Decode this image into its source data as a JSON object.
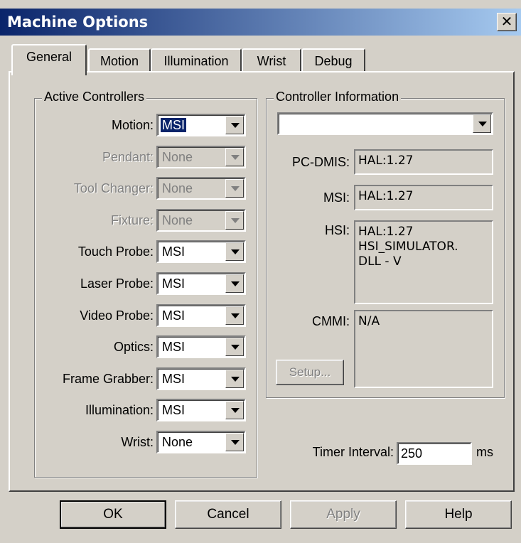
{
  "window": {
    "title": "Machine Options",
    "close_glyph": "✕"
  },
  "tabs": [
    "General",
    "Motion",
    "Illumination",
    "Wrist",
    "Debug"
  ],
  "active_controllers": {
    "title": "Active Controllers",
    "rows": [
      {
        "label": "Motion:",
        "value": "MSI",
        "disabled": false,
        "selected": true
      },
      {
        "label": "Pendant:",
        "value": "None",
        "disabled": true
      },
      {
        "label": "Tool Changer:",
        "value": "None",
        "disabled": true
      },
      {
        "label": "Fixture:",
        "value": "None",
        "disabled": true
      },
      {
        "label": "Touch Probe:",
        "value": "MSI",
        "disabled": false
      },
      {
        "label": "Laser Probe:",
        "value": "MSI",
        "disabled": false
      },
      {
        "label": "Video Probe:",
        "value": "MSI",
        "disabled": false
      },
      {
        "label": "Optics:",
        "value": "MSI",
        "disabled": false
      },
      {
        "label": "Frame Grabber:",
        "value": "MSI",
        "disabled": false
      },
      {
        "label": "Illumination:",
        "value": "MSI",
        "disabled": false
      },
      {
        "label": "Wrist:",
        "value": "None",
        "disabled": false
      }
    ]
  },
  "controller_info": {
    "title": "Controller Information",
    "select_value": "",
    "pcdmis_label": "PC-DMIS:",
    "pcdmis_value": "HAL:1.27",
    "msi_label": "MSI:",
    "msi_value": "HAL:1.27",
    "hsi_label": "HSI:",
    "hsi_value": "HAL:1.27\nHSI_SIMULATOR.\nDLL - V",
    "cmmi_label": "CMMI:",
    "cmmi_value": "N/A",
    "setup_label": "Setup..."
  },
  "timer": {
    "label": "Timer Interval:",
    "value": "250",
    "unit": "ms"
  },
  "buttons": {
    "ok": "OK",
    "cancel": "Cancel",
    "apply": "Apply",
    "help": "Help"
  },
  "colors": {
    "title_bar_start": "#0a246a",
    "title_bar_end": "#a6caf0",
    "dialog_bg": "#d4d0c8"
  }
}
